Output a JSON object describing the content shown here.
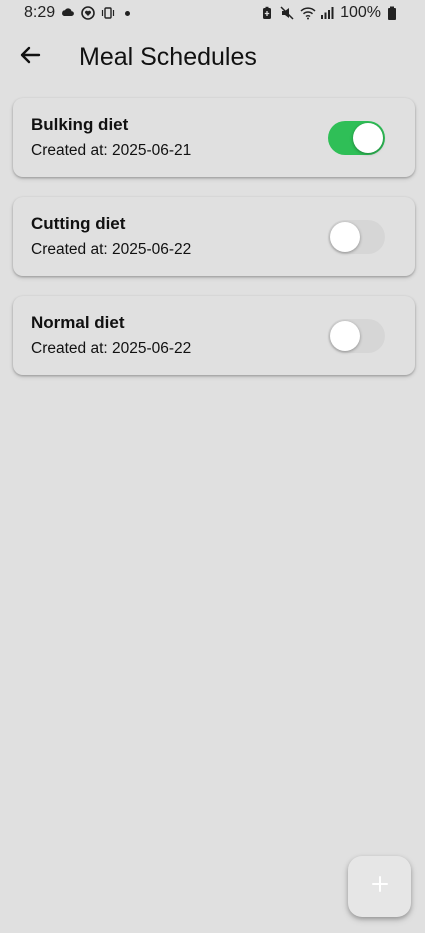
{
  "status_bar": {
    "time": "8:29",
    "battery": "100%",
    "icons_left": [
      "weather-icon",
      "health-icon",
      "vibration-icon",
      "dot-icon"
    ],
    "icons_right": [
      "battery-saver-icon",
      "mute-icon",
      "wifi-icon",
      "signal-icon",
      "battery-icon"
    ]
  },
  "app_bar": {
    "title": "Meal Schedules",
    "back_icon": "arrow-back-icon"
  },
  "schedules": [
    {
      "name": "Bulking diet",
      "created": "Created at: 2025-06-21",
      "active": true
    },
    {
      "name": "Cutting diet",
      "created": "Created at: 2025-06-22",
      "active": false
    },
    {
      "name": "Normal diet",
      "created": "Created at: 2025-06-22",
      "active": false
    }
  ],
  "fab": {
    "icon": "plus-icon"
  },
  "colors": {
    "background": "#e0e0e0",
    "toggle_on": "#2fbf57",
    "toggle_off": "#d6d6d6",
    "text": "#111111"
  }
}
